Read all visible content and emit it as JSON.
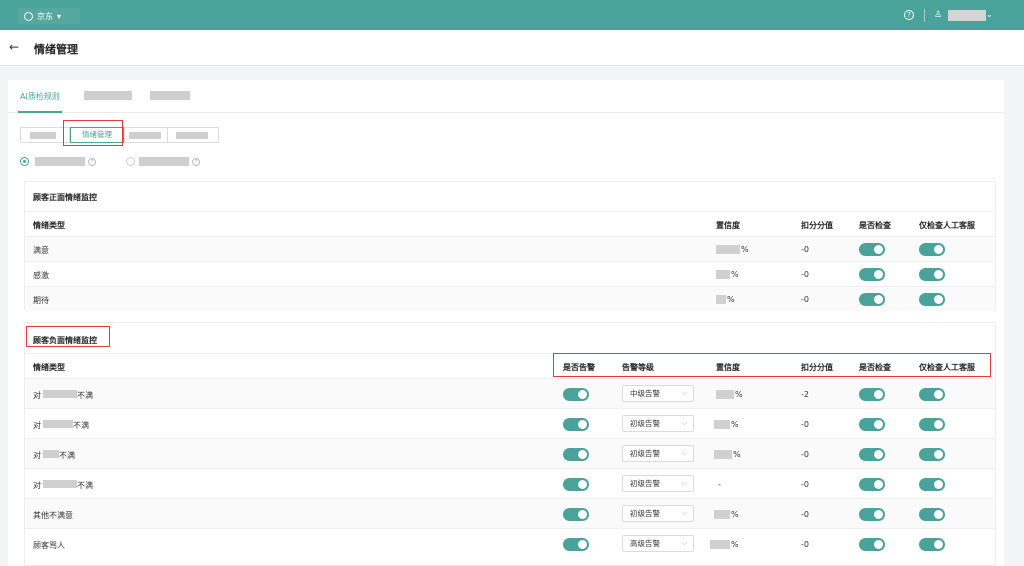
{
  "topbar": {
    "region": "京东",
    "region_caret": "▾",
    "help": "?",
    "user_caret": "⌄",
    "user_icon": "♙"
  },
  "header": {
    "back": "←",
    "title": "情绪管理"
  },
  "tabs": {
    "first": "AI质检规则"
  },
  "segments": {
    "active": "情绪管理"
  },
  "qmark": "?",
  "positive": {
    "title": "顾客正面情绪监控",
    "headers": {
      "type": "情绪类型",
      "confidence": "置信度",
      "deduct": "扣分分值",
      "check": "是否检查",
      "only_agent": "仅检查人工客服"
    },
    "rows": [
      {
        "type": "满意",
        "pct": "%",
        "deduct": "-0"
      },
      {
        "type": "感激",
        "pct": "%",
        "deduct": "-0"
      },
      {
        "type": "期待",
        "pct": "%",
        "deduct": "-0"
      }
    ]
  },
  "negative": {
    "title": "顾客负面情绪监控",
    "headers": {
      "type": "情绪类型",
      "alarm": "是否告警",
      "level": "告警等级",
      "confidence": "置信度",
      "deduct": "扣分分值",
      "check": "是否检查",
      "only_agent": "仅检查人工客服"
    },
    "rows": [
      {
        "prefix": "对",
        "suffix": "不满",
        "level": "中级告警",
        "pct": "%",
        "deduct": "-2"
      },
      {
        "prefix": "对",
        "suffix": "不满",
        "level": "初级告警",
        "pct": "%",
        "deduct": "-0"
      },
      {
        "prefix": "对",
        "suffix": "不满",
        "level": "初级告警",
        "pct": "%",
        "deduct": "-0"
      },
      {
        "prefix": "对",
        "suffix": "不满",
        "level": "初级告警",
        "pct": "-",
        "deduct": "-0"
      },
      {
        "prefix": "",
        "suffix": "其他不满意",
        "level": "初级告警",
        "pct": "%",
        "deduct": "-0"
      },
      {
        "prefix": "",
        "suffix": "顾客骂人",
        "level": "高级告警",
        "pct": "%",
        "deduct": "-0"
      }
    ]
  },
  "select_arrow": "⌵"
}
